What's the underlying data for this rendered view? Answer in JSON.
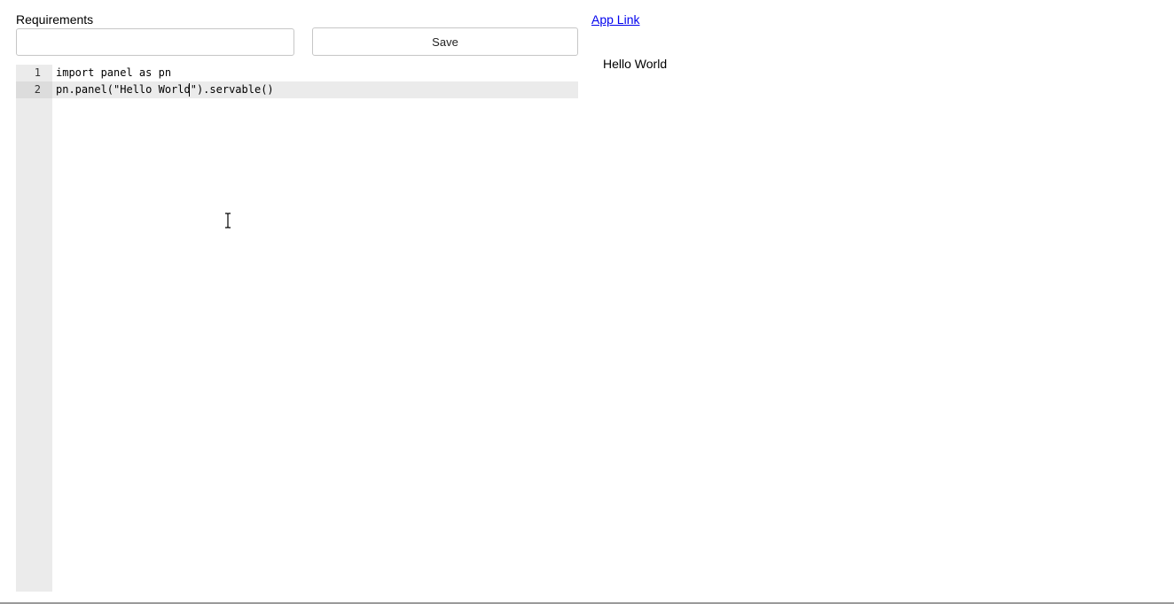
{
  "requirements": {
    "label": "Requirements",
    "value": "",
    "placeholder": ""
  },
  "toolbar": {
    "save_label": "Save"
  },
  "editor": {
    "lines": [
      {
        "number": "1",
        "code": "import panel as pn"
      },
      {
        "number": "2",
        "code": "pn.panel(\"Hello World\").servable()"
      }
    ],
    "active_line": 2
  },
  "preview": {
    "link_label": "App Link",
    "output_text": "Hello World"
  },
  "icons": {
    "text_cursor": "i-beam-cursor-icon"
  }
}
